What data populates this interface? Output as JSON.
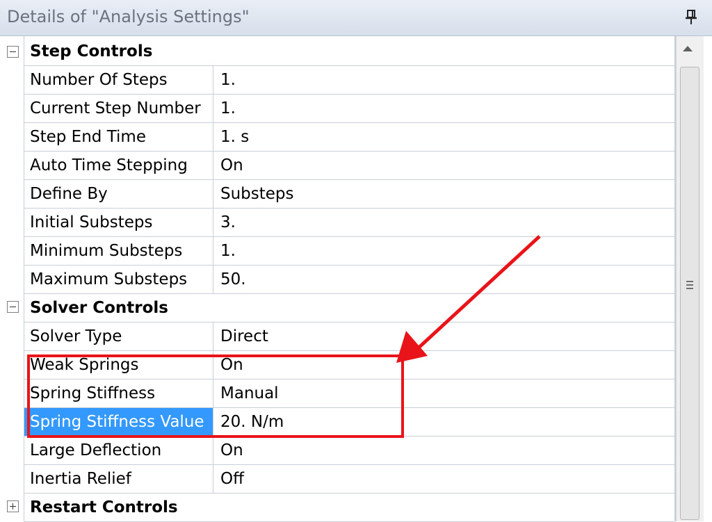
{
  "panel": {
    "title": "Details of \"Analysis Settings\""
  },
  "icons": {
    "pin": "pin-icon",
    "collapse": "minus-box-icon",
    "expand": "plus-box-icon",
    "scroll_up": "arrow-up-icon",
    "grip": "grip-icon"
  },
  "colors": {
    "selection": "#3399ff",
    "annotation": "#e8141a"
  },
  "groups": {
    "step_controls": {
      "label": "Step Controls",
      "rows": [
        {
          "label": "Number Of Steps",
          "value": "1."
        },
        {
          "label": "Current Step Number",
          "value": "1."
        },
        {
          "label": "Step End Time",
          "value": "1. s"
        },
        {
          "label": "Auto Time Stepping",
          "value": "On"
        },
        {
          "label": "Define By",
          "value": "Substeps"
        },
        {
          "label": "Initial Substeps",
          "value": "3."
        },
        {
          "label": "Minimum Substeps",
          "value": "1."
        },
        {
          "label": "Maximum Substeps",
          "value": "50."
        }
      ]
    },
    "solver_controls": {
      "label": "Solver Controls",
      "rows": [
        {
          "label": "Solver Type",
          "value": "Direct"
        },
        {
          "label": "Weak Springs",
          "value": "On"
        },
        {
          "label": "Spring Stiffness",
          "value": "Manual"
        },
        {
          "label": "Spring Stiffness Value",
          "value": "20. N/m"
        },
        {
          "label": "Large Deflection",
          "value": "On"
        },
        {
          "label": "Inertia Relief",
          "value": "Off"
        }
      ]
    },
    "restart_controls": {
      "label": "Restart Controls"
    }
  }
}
